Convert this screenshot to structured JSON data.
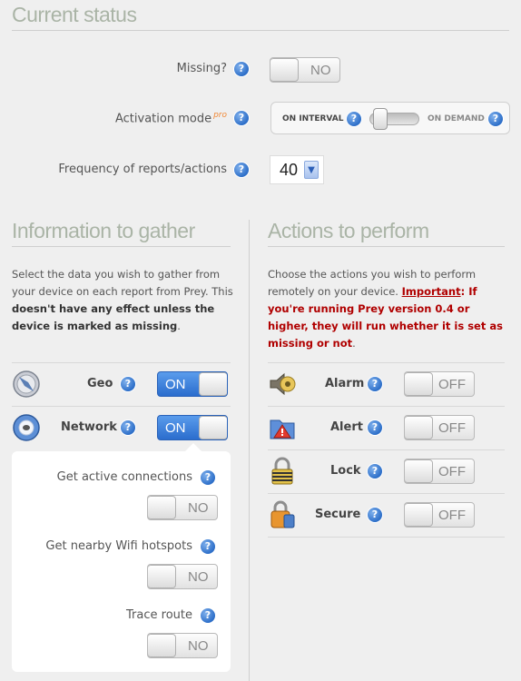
{
  "status": {
    "title": "Current status",
    "missing_label": "Missing?",
    "missing_value": "NO",
    "activation_label": "Activation mode",
    "activation_pro": "pro",
    "on_interval": "ON INTERVAL",
    "on_demand": "ON DEMAND",
    "frequency_label": "Frequency of reports/actions",
    "frequency_value": "40"
  },
  "gather": {
    "title": "Information to gather",
    "desc_1": "Select the data you wish to gather from your device on each report from Prey. This ",
    "desc_bold": "doesn't have any effect unless the device is marked as missing",
    "desc_2": ".",
    "items": [
      {
        "label": "Geo",
        "state": "ON"
      },
      {
        "label": "Network",
        "state": "ON"
      }
    ],
    "network_options": [
      {
        "label": "Get active connections",
        "state": "NO"
      },
      {
        "label": "Get nearby Wifi hotspots",
        "state": "NO"
      },
      {
        "label": "Trace route",
        "state": "NO"
      }
    ]
  },
  "actions": {
    "title": "Actions to perform",
    "desc_1": "Choose the actions you wish to perform remotely on your device. ",
    "important": "Important",
    "desc_warn": ": If you're running Prey version 0.4 or higher, they will run whether it is set as missing or not",
    "desc_2": ".",
    "items": [
      {
        "label": "Alarm",
        "state": "OFF"
      },
      {
        "label": "Alert",
        "state": "OFF"
      },
      {
        "label": "Lock",
        "state": "OFF"
      },
      {
        "label": "Secure",
        "state": "OFF"
      }
    ]
  },
  "colors": {
    "accent": "#2b6dcd",
    "title": "#aab4a6",
    "warning": "#b00000"
  }
}
